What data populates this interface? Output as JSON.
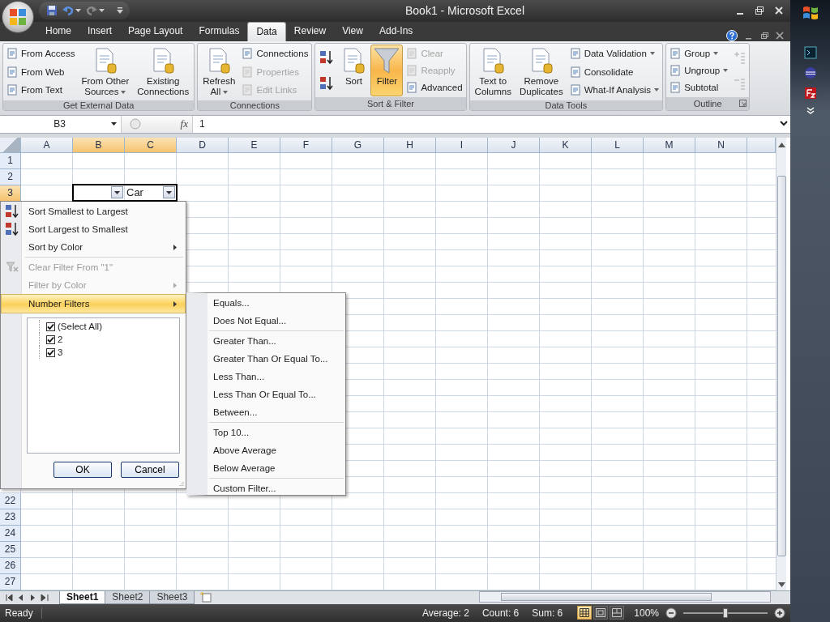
{
  "window": {
    "title": "Book1 - Microsoft Excel"
  },
  "quick_access": [
    {
      "kind": "save",
      "dropdown": false
    },
    {
      "kind": "undo",
      "dropdown": true
    },
    {
      "kind": "redo",
      "dropdown": true
    }
  ],
  "ribbon_tabs": [
    {
      "label": "Home",
      "selected": false
    },
    {
      "label": "Insert",
      "selected": false
    },
    {
      "label": "Page Layout",
      "selected": false
    },
    {
      "label": "Formulas",
      "selected": false
    },
    {
      "label": "Data",
      "selected": true
    },
    {
      "label": "Review",
      "selected": false
    },
    {
      "label": "View",
      "selected": false
    },
    {
      "label": "Add-Ins",
      "selected": false
    }
  ],
  "ribbon_groups": [
    {
      "title": "Get External Data",
      "launcher": false,
      "columns": [
        {
          "kind": "stack",
          "items": [
            {
              "label": "From Access",
              "disabled": false,
              "dropdown": false
            },
            {
              "label": "From Web",
              "disabled": false,
              "dropdown": false
            },
            {
              "label": "From Text",
              "disabled": false,
              "dropdown": false
            }
          ]
        },
        {
          "kind": "large",
          "lines": [
            "From Other",
            "Sources"
          ],
          "dropdown": true,
          "selected": false
        },
        {
          "kind": "large",
          "lines": [
            "Existing",
            "Connections"
          ],
          "dropdown": false,
          "selected": false
        }
      ]
    },
    {
      "title": "Connections",
      "launcher": false,
      "columns": [
        {
          "kind": "large",
          "lines": [
            "Refresh",
            "All"
          ],
          "dropdown": true,
          "selected": false
        },
        {
          "kind": "stack",
          "items": [
            {
              "label": "Connections",
              "disabled": false,
              "dropdown": false
            },
            {
              "label": "Properties",
              "disabled": true,
              "dropdown": false
            },
            {
              "label": "Edit Links",
              "disabled": true,
              "dropdown": false
            }
          ]
        }
      ]
    },
    {
      "title": "Sort & Filter",
      "launcher": false,
      "columns": [
        {
          "kind": "sortbuttons"
        },
        {
          "kind": "large",
          "lines": [
            "Sort"
          ],
          "dropdown": false,
          "selected": false
        },
        {
          "kind": "filter",
          "lines": [
            "Filter"
          ],
          "dropdown": false,
          "selected": true
        },
        {
          "kind": "stack",
          "items": [
            {
              "label": "Clear",
              "disabled": true,
              "dropdown": false
            },
            {
              "label": "Reapply",
              "disabled": true,
              "dropdown": false
            },
            {
              "label": "Advanced",
              "disabled": false,
              "dropdown": false
            }
          ]
        }
      ]
    },
    {
      "title": "Data Tools",
      "launcher": false,
      "columns": [
        {
          "kind": "large",
          "lines": [
            "Text to",
            "Columns"
          ],
          "dropdown": false,
          "selected": false
        },
        {
          "kind": "large",
          "lines": [
            "Remove",
            "Duplicates"
          ],
          "dropdown": false,
          "selected": false
        },
        {
          "kind": "stack",
          "items": [
            {
              "label": "Data Validation",
              "disabled": false,
              "dropdown": true
            },
            {
              "label": "Consolidate",
              "disabled": false,
              "dropdown": false
            },
            {
              "label": "What-If Analysis",
              "disabled": false,
              "dropdown": true
            }
          ]
        }
      ]
    },
    {
      "title": "Outline",
      "launcher": true,
      "columns": [
        {
          "kind": "stack",
          "items": [
            {
              "label": "Group",
              "disabled": false,
              "dropdown": true
            },
            {
              "label": "Ungroup",
              "disabled": false,
              "dropdown": true
            },
            {
              "label": "Subtotal",
              "disabled": false,
              "dropdown": false
            }
          ]
        },
        {
          "kind": "detailbuttons"
        }
      ]
    }
  ],
  "formula_bar": {
    "name_box": "B3",
    "fx": "fx",
    "value": "1"
  },
  "grid": {
    "columns": [
      {
        "label": "A",
        "selected": false
      },
      {
        "label": "B",
        "selected": true
      },
      {
        "label": "C",
        "selected": true
      },
      {
        "label": "D",
        "selected": false
      },
      {
        "label": "E",
        "selected": false
      },
      {
        "label": "F",
        "selected": false
      },
      {
        "label": "G",
        "selected": false
      },
      {
        "label": "H",
        "selected": false
      },
      {
        "label": "I",
        "selected": false
      },
      {
        "label": "J",
        "selected": false
      },
      {
        "label": "K",
        "selected": false
      },
      {
        "label": "L",
        "selected": false
      },
      {
        "label": "M",
        "selected": false
      },
      {
        "label": "N",
        "selected": false
      }
    ],
    "rows_top": [
      {
        "label": "1",
        "selected": false
      },
      {
        "label": "2",
        "selected": false
      },
      {
        "label": "3",
        "selected": true
      }
    ],
    "filter_cells": [
      {
        "kind": "blank"
      },
      {
        "kind": "text",
        "text": "Car"
      }
    ],
    "rows_bottom": [
      {
        "label": "22",
        "selected": false
      },
      {
        "label": "23",
        "selected": false
      },
      {
        "label": "24",
        "selected": false
      },
      {
        "label": "25",
        "selected": false
      },
      {
        "label": "26",
        "selected": false
      },
      {
        "label": "27",
        "selected": false
      }
    ]
  },
  "filter_menu": {
    "items": [
      {
        "kind": "sortasc",
        "label": "Sort Smallest to Largest",
        "disabled": false,
        "submenu": false,
        "selected": false,
        "separator_before": false
      },
      {
        "kind": "sortdesc",
        "label": "Sort Largest to Smallest",
        "disabled": false,
        "submenu": false,
        "selected": false,
        "separator_before": false
      },
      {
        "kind": "plain",
        "label": "Sort by Color",
        "disabled": false,
        "submenu": true,
        "selected": false,
        "separator_before": false
      },
      {
        "kind": "clearfilter",
        "label": "Clear Filter From \"1\"",
        "disabled": true,
        "submenu": false,
        "selected": false,
        "separator_before": true
      },
      {
        "kind": "plain",
        "label": "Filter by Color",
        "disabled": true,
        "submenu": true,
        "selected": false,
        "separator_before": false
      },
      {
        "kind": "plain",
        "label": "Number Filters",
        "disabled": false,
        "submenu": true,
        "selected": true,
        "separator_before": false
      }
    ],
    "values": [
      {
        "label": "(Select All)",
        "checked": true
      },
      {
        "label": "2",
        "checked": true
      },
      {
        "label": "3",
        "checked": true
      }
    ],
    "buttons": [
      "OK",
      "Cancel"
    ]
  },
  "number_filters_menu": [
    {
      "label": "Equals...",
      "separator_before": false
    },
    {
      "label": "Does Not Equal...",
      "separator_before": false
    },
    {
      "label": "Greater Than...",
      "separator_before": true
    },
    {
      "label": "Greater Than Or Equal To...",
      "separator_before": false
    },
    {
      "label": "Less Than...",
      "separator_before": false
    },
    {
      "label": "Less Than Or Equal To...",
      "separator_before": false
    },
    {
      "label": "Between...",
      "separator_before": false
    },
    {
      "label": "Top 10...",
      "separator_before": true
    },
    {
      "label": "Above Average",
      "separator_before": false
    },
    {
      "label": "Below Average",
      "separator_before": false
    },
    {
      "label": "Custom Filter...",
      "separator_before": true
    }
  ],
  "sheet_tabs": [
    {
      "label": "Sheet1",
      "selected": true
    },
    {
      "label": "Sheet2",
      "selected": false
    },
    {
      "label": "Sheet3",
      "selected": false
    }
  ],
  "status_bar": {
    "mode": "Ready",
    "stats": [
      "Average: 2",
      "Count: 6",
      "Sum: 6"
    ],
    "views": [
      {
        "kind": "normal",
        "selected": true
      },
      {
        "kind": "layout",
        "selected": false
      },
      {
        "kind": "pagebreak",
        "selected": false
      }
    ],
    "zoom": "100%",
    "zoom_slider": {
      "level": 0.5
    }
  }
}
